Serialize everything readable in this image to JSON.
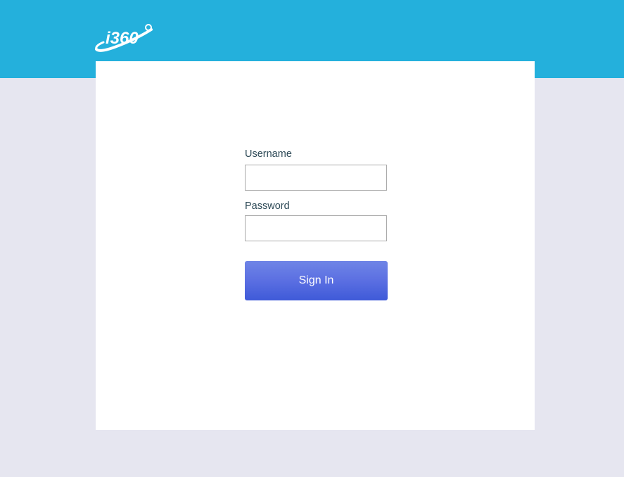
{
  "brand": {
    "logo_text": "i360",
    "header_color": "#24b0dc",
    "background_color": "#e6e6f0",
    "button_color": "#5269e0"
  },
  "login_form": {
    "username_label": "Username",
    "username_value": "",
    "password_label": "Password",
    "password_value": "",
    "signin_label": "Sign In"
  }
}
